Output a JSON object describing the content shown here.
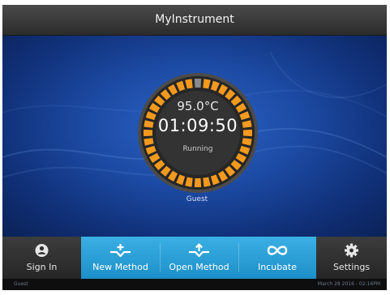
{
  "app": {
    "title": "MyInstrument"
  },
  "run": {
    "temperature": "95.0°C",
    "time_remaining": "01:09:50",
    "status": "Running",
    "progress_fraction": 0.03,
    "user": "Guest"
  },
  "toolbar": {
    "sign_in": {
      "label": "Sign In",
      "icon": "user-icon"
    },
    "new_method": {
      "label": "New Method",
      "icon": "new-method-icon"
    },
    "open_method": {
      "label": "Open Method",
      "icon": "open-method-icon"
    },
    "incubate": {
      "label": "Incubate",
      "icon": "infinity-icon"
    },
    "settings": {
      "label": "Settings",
      "icon": "gear-icon"
    }
  },
  "status_bar": {
    "user": "Guest",
    "datetime": "March 28 2016 - 02:16PM"
  },
  "colors": {
    "accent": "#1c98d4",
    "ring_active": "#f39a1e",
    "ring_inactive": "#8a8a8a",
    "dial_bg": "#2e2e2e"
  }
}
